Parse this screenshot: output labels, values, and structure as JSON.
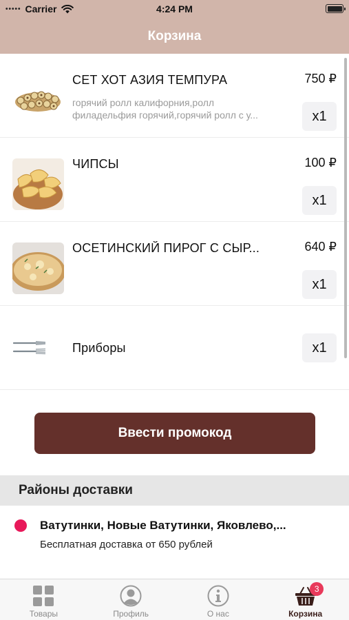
{
  "status_bar": {
    "carrier": "Carrier",
    "time": "4:24 PM"
  },
  "nav": {
    "title": "Корзина"
  },
  "cart": {
    "items": [
      {
        "name": "СЕТ ХОТ АЗИЯ ТЕМПУРА",
        "desc_line1": "горячий ролл калифорния,ролл",
        "desc_line2": "филадельфия горячий,горячий ролл с у...",
        "price": "750 ₽",
        "qty": "x1"
      },
      {
        "name": "ЧИПСЫ",
        "price": "100 ₽",
        "qty": "x1"
      },
      {
        "name": "ОСЕТИНСКИЙ ПИРОГ С СЫР...",
        "price": "640 ₽",
        "qty": "x1"
      }
    ],
    "cutlery": {
      "name": "Приборы",
      "qty": "x1"
    }
  },
  "promo_button": {
    "label": "Ввести промокод"
  },
  "delivery": {
    "header": "Районы доставки",
    "zones": [
      {
        "name": "Ватутинки, Новые Ватутинки, Яковлево,...",
        "note": "Бесплатная доставка от 650 рублей",
        "color": "#e8195a"
      }
    ]
  },
  "tabs": [
    {
      "label": "Товары",
      "icon": "grid-icon",
      "active": false
    },
    {
      "label": "Профиль",
      "icon": "profile-icon",
      "active": false
    },
    {
      "label": "О нас",
      "icon": "info-icon",
      "active": false
    },
    {
      "label": "Корзина",
      "icon": "basket-icon",
      "active": true,
      "badge": "3"
    }
  ],
  "colors": {
    "header": "#d1b5aa",
    "accent": "#64302b",
    "badge": "#e8395a",
    "zone_dot": "#e8195a"
  }
}
